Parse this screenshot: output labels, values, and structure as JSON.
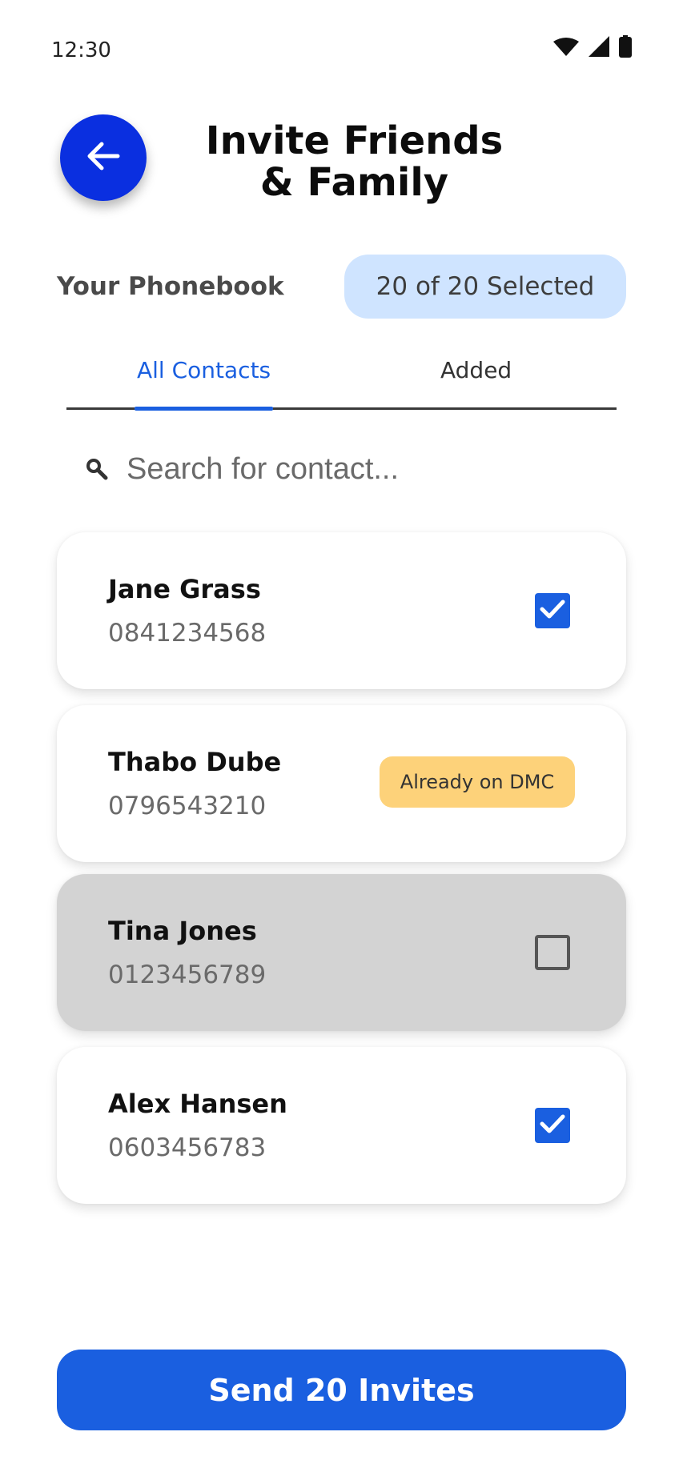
{
  "status_bar": {
    "time": "12:30"
  },
  "header": {
    "title": "Invite Friends\n& Family"
  },
  "phonebook": {
    "label": "Your Phonebook",
    "selected_text": "20 of 20 Selected"
  },
  "tabs": [
    {
      "label": "All Contacts",
      "active": true
    },
    {
      "label": "Added",
      "active": false
    }
  ],
  "search": {
    "placeholder": "Search for contact...",
    "value": ""
  },
  "contacts": [
    {
      "name": "Jane Grass",
      "phone": "0841234568",
      "state": "checked"
    },
    {
      "name": "Thabo Dube",
      "phone": "0796543210",
      "state": "already",
      "badge": "Already on DMC"
    },
    {
      "name": "Tina Jones",
      "phone": "0123456789",
      "state": "unchecked"
    },
    {
      "name": "Alex Hansen",
      "phone": "0603456783",
      "state": "checked"
    }
  ],
  "footer": {
    "send_label": "Send 20 Invites"
  },
  "colors": {
    "primary": "#1a5fe0",
    "back_button": "#0a2fe0",
    "selected_badge": "#cfe4ff",
    "dmc_badge": "#fdd27a",
    "disabled_card": "#d3d3d3"
  },
  "icons": [
    "wifi-icon",
    "signal-icon",
    "battery-icon",
    "arrow-left-icon",
    "search-icon",
    "check-icon"
  ]
}
